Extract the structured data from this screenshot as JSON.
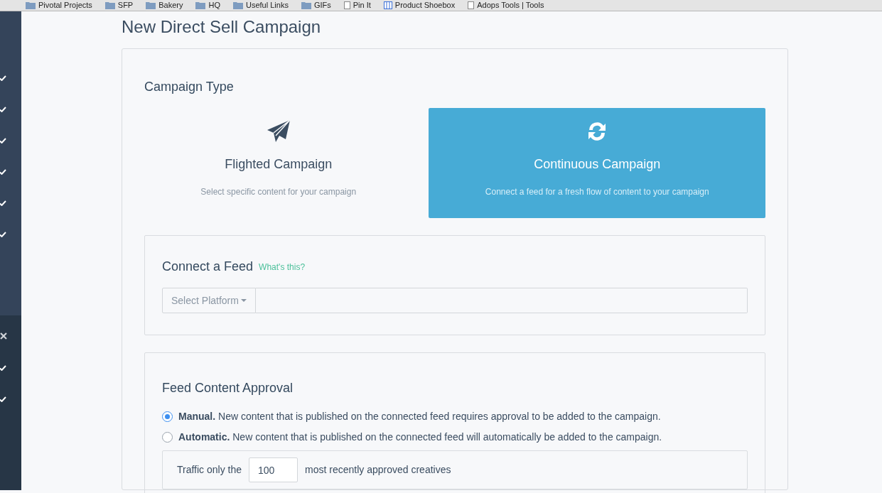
{
  "bookmarks": [
    {
      "label": "Pivotal Projects",
      "kind": "folder"
    },
    {
      "label": "SFP",
      "kind": "folder"
    },
    {
      "label": "Bakery",
      "kind": "folder"
    },
    {
      "label": "HQ",
      "kind": "folder"
    },
    {
      "label": "Useful Links",
      "kind": "folder"
    },
    {
      "label": "GIFs",
      "kind": "folder"
    },
    {
      "label": "Pin It",
      "kind": "page"
    },
    {
      "label": "Product Shoebox",
      "kind": "app"
    },
    {
      "label": "Adops Tools | Tools",
      "kind": "page"
    }
  ],
  "sidebar": {
    "sections": [
      {
        "items": [
          {
            "kind": "check"
          },
          {
            "kind": "check"
          },
          {
            "kind": "check"
          },
          {
            "kind": "check"
          },
          {
            "kind": "check"
          },
          {
            "kind": "check"
          }
        ]
      },
      {
        "items": [
          {
            "kind": "cross"
          },
          {
            "kind": "check"
          },
          {
            "kind": "check"
          }
        ]
      }
    ]
  },
  "page_title": "New Direct Sell Campaign",
  "campaign_type": {
    "heading": "Campaign Type",
    "options": [
      {
        "kind": "plane",
        "title": "Flighted Campaign",
        "description": "Select specific content for your campaign",
        "selected": false
      },
      {
        "kind": "refresh",
        "title": "Continuous Campaign",
        "description": "Connect a feed for a fresh flow of content to your campaign",
        "selected": true
      }
    ]
  },
  "feed": {
    "heading": "Connect a Feed",
    "help_link": "What's this?",
    "platform_select": "Select Platform"
  },
  "approval": {
    "heading": "Feed Content Approval",
    "options": [
      {
        "text": "**Manual.** New content that is published on the connected feed requires approval to be added to the campaign.",
        "selected": true
      },
      {
        "text": "**Automatic.** New content that is published on the connected feed will automatically be added to the campaign.",
        "selected": false
      }
    ],
    "traffic": {
      "prefix": "Traffic only the",
      "value": "100",
      "suffix": "most recently approved creatives"
    }
  }
}
